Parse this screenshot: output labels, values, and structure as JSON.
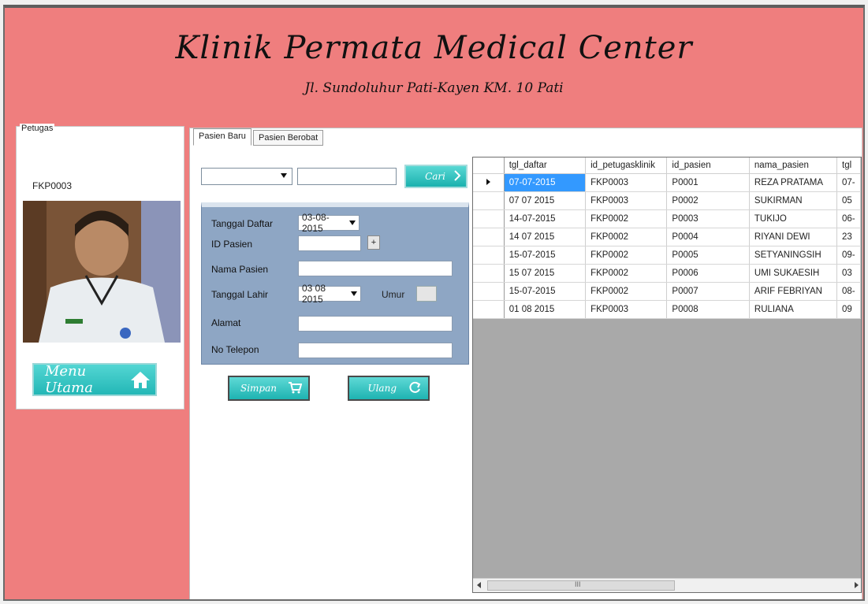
{
  "header": {
    "title": "Klinik Permata Medical Center",
    "subtitle": "Jl. Sundoluhur Pati-Kayen KM. 10 Pati"
  },
  "petugas": {
    "legend": "Petugas",
    "id": "FKP0003",
    "menu_button": "Menu Utama"
  },
  "tabs": [
    "Pasien Baru",
    "Pasien Berobat"
  ],
  "search": {
    "button": "Cari"
  },
  "form": {
    "tanggal_daftar_label": "Tanggal Daftar",
    "tanggal_daftar_value": "03-08-2015",
    "id_pasien_label": "ID Pasien",
    "plus_label": "+",
    "nama_pasien_label": "Nama Pasien",
    "tanggal_lahir_label": "Tanggal Lahir",
    "tanggal_lahir_value": "03 08 2015",
    "umur_label": "Umur",
    "alamat_label": "Alamat",
    "no_telepon_label": "No Telepon"
  },
  "actions": {
    "simpan": "Simpan",
    "ulang": "Ulang"
  },
  "grid": {
    "columns": [
      "tgl_daftar",
      "id_petugasklinik",
      "id_pasien",
      "nama_pasien",
      "tgl"
    ],
    "rows": [
      [
        "07-07-2015",
        "FKP0003",
        "P0001",
        "REZA PRATAMA",
        "07-"
      ],
      [
        "07 07 2015",
        "FKP0003",
        "P0002",
        "SUKIRMAN",
        "05"
      ],
      [
        "14-07-2015",
        "FKP0002",
        "P0003",
        "TUKIJO",
        "06-"
      ],
      [
        "14 07 2015",
        "FKP0002",
        "P0004",
        "RIYANI DEWI",
        "23"
      ],
      [
        "15-07-2015",
        "FKP0002",
        "P0005",
        "SETYANINGSIH",
        "09-"
      ],
      [
        "15 07 2015",
        "FKP0002",
        "P0006",
        "UMI SUKAESIH",
        "03"
      ],
      [
        "15-07-2015",
        "FKP0002",
        "P0007",
        "ARIF FEBRIYAN",
        "08-"
      ],
      [
        "01 08 2015",
        "FKP0003",
        "P0008",
        "RULIANA",
        "09"
      ]
    ],
    "scroll_thumb_label": "III"
  },
  "colors": {
    "background": "#ef7e7e",
    "form_panel": "#8ea6c4",
    "accent_button": "#23b7b6",
    "selected_cell": "#3399ff"
  }
}
